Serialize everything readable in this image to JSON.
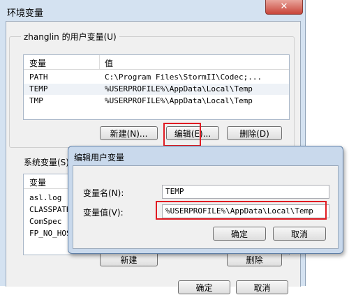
{
  "env_window": {
    "title": "环境变量",
    "close_symbol": "✕",
    "user_vars": {
      "group_label": "zhanglin 的用户变量(U)",
      "columns": [
        "变量",
        "值"
      ],
      "rows": [
        {
          "name": "PATH",
          "value": "C:\\Program Files\\StormII\\Codec;..."
        },
        {
          "name": "TEMP",
          "value": "%USERPROFILE%\\AppData\\Local\\Temp"
        },
        {
          "name": "TMP",
          "value": "%USERPROFILE%\\AppData\\Local\\Temp"
        }
      ],
      "new_button": "新建(N)...",
      "edit_button": "编辑(E)...",
      "delete_button": "删除(D)"
    },
    "system_vars": {
      "group_label": "系统变量(S)",
      "columns": [
        "变量"
      ],
      "rows": [
        "asl.log",
        "CLASSPATH",
        "ComSpec",
        "FP_NO_HOST"
      ],
      "new_button": "新建",
      "delete_button": "删除"
    },
    "ok_button": "确定",
    "cancel_button": "取消"
  },
  "edit_dialog": {
    "title": "编辑用户变量",
    "name_label": "变量名(N):",
    "name_value": "TEMP",
    "value_label": "变量值(V):",
    "value_value": "%USERPROFILE%\\AppData\\Local\\Temp",
    "ok_button": "确定",
    "cancel_button": "取消"
  },
  "colors": {
    "highlight": "#e11b22",
    "title_bar": "#d4e2f1",
    "dialog_title_bar": "#c9d9ec"
  }
}
